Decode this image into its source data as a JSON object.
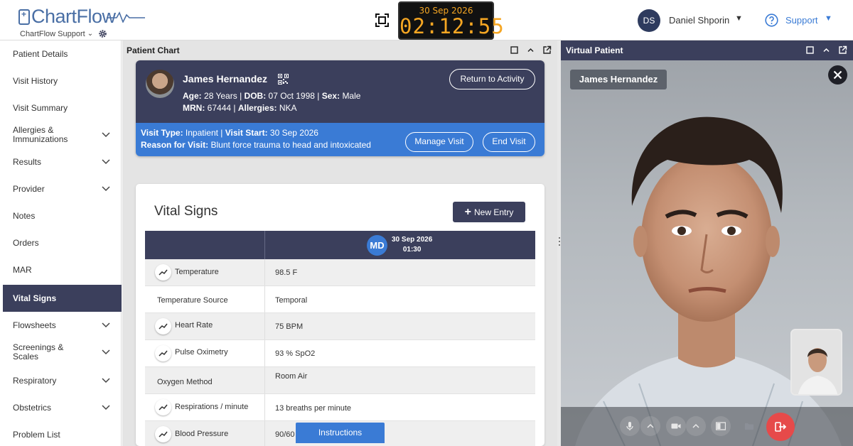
{
  "header": {
    "logo_text": "ChartFlow",
    "support_org": "ChartFlow Support",
    "clock_date": "30 Sep 2026",
    "clock_time": "02:12:55",
    "user_initials": "DS",
    "user_name": "Daniel Shporin",
    "support_label": "Support",
    "colors": {
      "brand": "#4a6fa5",
      "clock": "#f5a623",
      "navy": "#3b3f5c",
      "blue": "#3a7bd5"
    }
  },
  "sidebar": {
    "items": [
      {
        "label": "Patient Details",
        "expandable": false
      },
      {
        "label": "Visit History",
        "expandable": false
      },
      {
        "label": "Visit Summary",
        "expandable": false
      },
      {
        "label": "Allergies & Immunizations",
        "expandable": true
      },
      {
        "label": "Results",
        "expandable": true
      },
      {
        "label": "Provider",
        "expandable": true
      },
      {
        "label": "Notes",
        "expandable": false
      },
      {
        "label": "Orders",
        "expandable": false
      },
      {
        "label": "MAR",
        "expandable": false
      },
      {
        "label": "Vital Signs",
        "expandable": false,
        "active": true
      },
      {
        "label": "Flowsheets",
        "expandable": true
      },
      {
        "label": "Screenings & Scales",
        "expandable": true
      },
      {
        "label": "Respiratory",
        "expandable": true
      },
      {
        "label": "Obstetrics",
        "expandable": true
      },
      {
        "label": "Problem List",
        "expandable": false
      }
    ]
  },
  "chart_panel": {
    "title": "Patient Chart",
    "patient": {
      "name": "James Hernandez",
      "age_label": "Age:",
      "age": "28 Years",
      "dob_label": "DOB:",
      "dob": "07 Oct 1998",
      "sex_label": "Sex:",
      "sex": "Male",
      "mrn_label": "MRN:",
      "mrn": "67444",
      "allergies_label": "Allergies:",
      "allergies": "NKA",
      "return_button": "Return to Activity",
      "visit_type_label": "Visit Type:",
      "visit_type": "Inpatient",
      "visit_start_label": "Visit Start:",
      "visit_start": "30 Sep 2026",
      "reason_label": "Reason for Visit:",
      "reason": "Blunt force trauma to head and intoxicated",
      "manage_button": "Manage Visit",
      "end_button": "End Visit"
    },
    "vitals": {
      "title": "Vital Signs",
      "new_entry": "New Entry",
      "column_initials": "MD",
      "column_date": "30 Sep 2026",
      "column_time": "01:30",
      "rows": [
        {
          "label": "Temperature",
          "value": "98.5 F",
          "trend": true
        },
        {
          "label": "Temperature Source",
          "value": "Temporal",
          "trend": false
        },
        {
          "label": "Heart Rate",
          "value": "75 BPM",
          "trend": true
        },
        {
          "label": "Pulse Oximetry",
          "value": "93 % SpO2",
          "trend": true
        },
        {
          "label": "Oxygen Method",
          "value": "Room Air",
          "trend": false
        },
        {
          "label": "Respirations / minute",
          "value": "13 breaths per minute",
          "trend": true
        },
        {
          "label": "Blood Pressure",
          "value": "90/60",
          "trend": true
        }
      ]
    },
    "instructions": "Instructions"
  },
  "virtual_patient": {
    "title": "Virtual Patient",
    "name_tag": "James Hernandez"
  }
}
